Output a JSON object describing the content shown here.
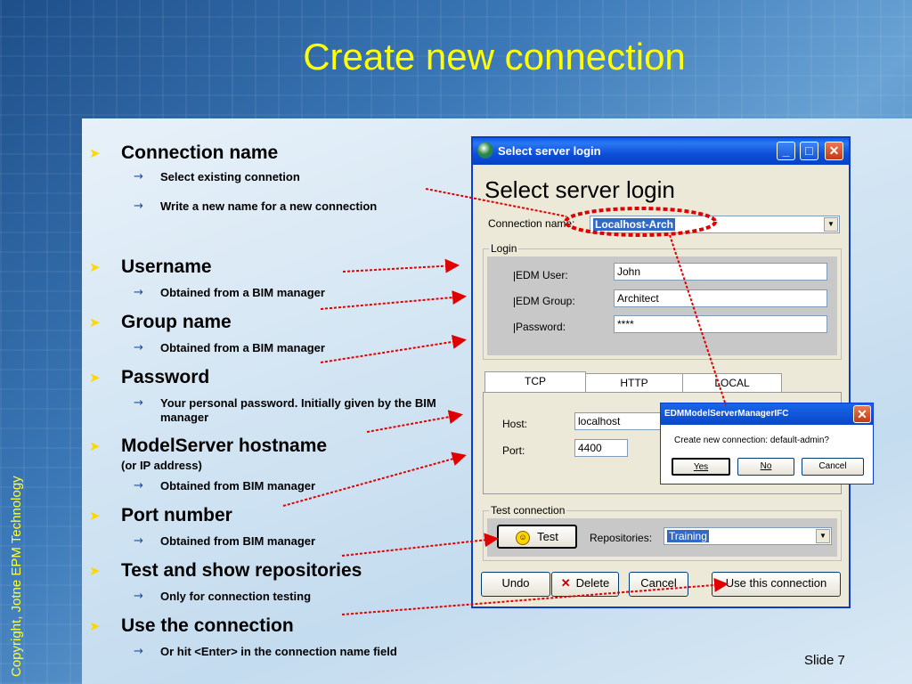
{
  "slide": {
    "title": "Create new connection",
    "copyright": "Copyright, Jotne EPM Technology",
    "slide_number": "Slide 7"
  },
  "bullets": [
    {
      "label": "Connection name",
      "subs": [
        "Select existing connetion",
        "Write a new name for a new connection"
      ]
    },
    {
      "label": "Username",
      "subs": [
        "Obtained from a BIM manager"
      ]
    },
    {
      "label": "Group name",
      "subs": [
        "Obtained from a BIM manager"
      ]
    },
    {
      "label": "Password",
      "subs": [
        "Your personal password. Initially given by the BIM manager"
      ]
    },
    {
      "label": "ModelServer hostname",
      "note": "(or IP address)",
      "subs": [
        "Obtained from BIM manager"
      ]
    },
    {
      "label": "Port number",
      "subs": [
        "Obtained from BIM manager"
      ]
    },
    {
      "label": "Test and show repositories",
      "subs": [
        "Only for connection testing"
      ]
    },
    {
      "label": "Use the connection",
      "subs": [
        "Or hit <Enter> in the connection name field"
      ]
    }
  ],
  "dialog": {
    "window_title": "Select server login",
    "heading": "Select server login",
    "connection_name_label": "Connection name:",
    "connection_name_value": "Localhost-Arch",
    "login_group_title": "Login",
    "edm_user_label": "EDM User:",
    "edm_user_value": "John",
    "edm_group_label": "EDM Group:",
    "edm_group_value": "Architect",
    "password_label": "Password:",
    "password_value": "****",
    "tabs": [
      "TCP",
      "HTTP",
      "LOCAL"
    ],
    "host_label": "Host:",
    "host_value": "localhost",
    "port_label": "Port:",
    "port_value": "4400",
    "test_group_title": "Test connection",
    "test_button": "Test",
    "repositories_label": "Repositories:",
    "repositories_value": "Training",
    "undo_button": "Undo",
    "delete_button": "Delete",
    "cancel_button": "Cancel",
    "use_button": "Use this connection"
  },
  "msgbox": {
    "title": "EDMModelServerManagerIFC",
    "message": "Create new connection: default-admin?",
    "yes": "Yes",
    "no": "No",
    "cancel": "Cancel"
  },
  "colors": {
    "title": "#ffff00",
    "bullet_marker": "#ffd700",
    "annotation_line": "#e00000",
    "xp_blue": "#0a5ee8"
  }
}
